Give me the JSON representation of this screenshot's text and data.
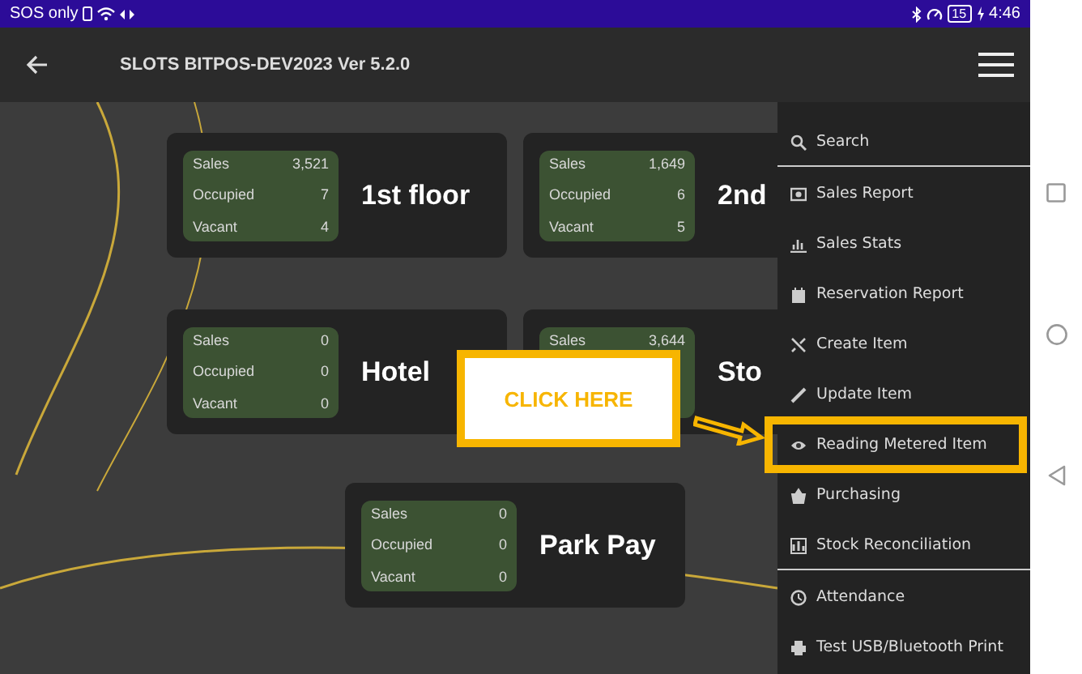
{
  "status_bar": {
    "carrier": "SOS only",
    "battery": "15",
    "time": "4:46"
  },
  "app_bar": {
    "title": "SLOTS BITPOS-DEV2023 Ver 5.2.0"
  },
  "areas": [
    {
      "name": "1st floor",
      "stats": [
        {
          "label": "Sales",
          "value": "3,521"
        },
        {
          "label": "Occupied",
          "value": "7"
        },
        {
          "label": "Vacant",
          "value": "4"
        }
      ]
    },
    {
      "name": "2nd",
      "stats": [
        {
          "label": "Sales",
          "value": "1,649"
        },
        {
          "label": "Occupied",
          "value": "6"
        },
        {
          "label": "Vacant",
          "value": "5"
        }
      ]
    },
    {
      "name": "Hotel",
      "stats": [
        {
          "label": "Sales",
          "value": "0"
        },
        {
          "label": "Occupied",
          "value": "0"
        },
        {
          "label": "Vacant",
          "value": "0"
        }
      ]
    },
    {
      "name": "Sto",
      "stats": [
        {
          "label": "Sales",
          "value": "3,644"
        }
      ]
    },
    {
      "name": "Park Pay",
      "stats": [
        {
          "label": "Sales",
          "value": "0"
        },
        {
          "label": "Occupied",
          "value": "0"
        },
        {
          "label": "Vacant",
          "value": "0"
        }
      ]
    }
  ],
  "menu": {
    "groups": [
      [
        {
          "label": "Search",
          "highlighted": false
        }
      ],
      [
        {
          "label": "Sales Report",
          "highlighted": false
        },
        {
          "label": "Sales Stats",
          "highlighted": false
        },
        {
          "label": "Reservation Report",
          "highlighted": false
        },
        {
          "label": "Create Item",
          "highlighted": false
        },
        {
          "label": "Update Item",
          "highlighted": false
        },
        {
          "label": "Reading Metered Item",
          "highlighted": true
        },
        {
          "label": "Purchasing",
          "highlighted": false
        },
        {
          "label": "Stock Reconciliation",
          "highlighted": false
        }
      ],
      [
        {
          "label": "Attendance",
          "highlighted": false
        },
        {
          "label": "Test USB/Bluetooth Print",
          "highlighted": false
        }
      ]
    ]
  },
  "callout": {
    "text": "CLICK HERE"
  }
}
